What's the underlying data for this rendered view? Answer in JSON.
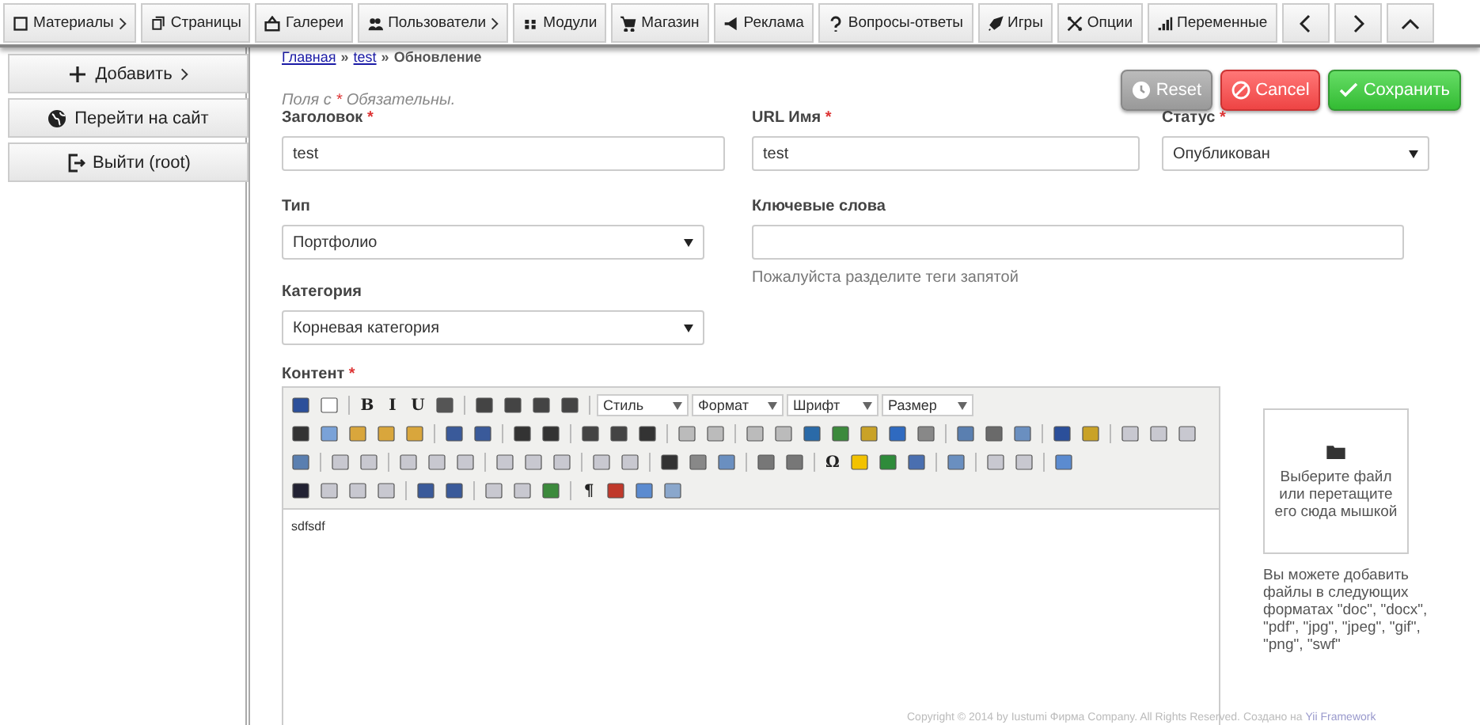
{
  "nav": {
    "items": [
      {
        "label": "Материалы",
        "submenu": true
      },
      {
        "label": "Страницы",
        "submenu": false
      },
      {
        "label": "Галереи",
        "submenu": false
      },
      {
        "label": "Пользователи",
        "submenu": true
      },
      {
        "label": "Модули",
        "submenu": false
      },
      {
        "label": "Магазин",
        "submenu": false
      },
      {
        "label": "Реклама",
        "submenu": false
      },
      {
        "label": "Вопросы-ответы",
        "submenu": false
      },
      {
        "label": "Игры",
        "submenu": false
      },
      {
        "label": "Опции",
        "submenu": false
      },
      {
        "label": "Переменные",
        "submenu": false
      }
    ]
  },
  "sidebar": {
    "buttons": [
      {
        "label": "Добавить",
        "submenu": true
      },
      {
        "label": "Перейти на сайт",
        "submenu": false
      },
      {
        "label": "Выйти (root)",
        "submenu": false
      }
    ]
  },
  "breadcrumb": [
    {
      "label": "Главная",
      "link": true
    },
    {
      "label": "test",
      "link": true
    },
    {
      "label": "Обновление",
      "link": false
    }
  ],
  "breadcrumb_separator": "»",
  "required_note": {
    "before": "Поля с",
    "mark": "*",
    "after": "Обязательны."
  },
  "actions": [
    {
      "label": "Reset",
      "kind": "reset"
    },
    {
      "label": "Cancel",
      "kind": "cancel"
    },
    {
      "label": "Сохранить",
      "kind": "save"
    }
  ],
  "fields": {
    "title": {
      "label": "Заголовок",
      "required": true,
      "value": "test"
    },
    "url": {
      "label": "URL Имя",
      "required": true,
      "value": "test"
    },
    "status": {
      "label": "Статус",
      "required": true,
      "value": "Опубликован"
    },
    "type": {
      "label": "Тип",
      "required": false,
      "value": "Портфолио"
    },
    "keywords": {
      "label": "Ключевые слова",
      "required": false,
      "hint": "Пожалуйста разделите теги запятой"
    },
    "category": {
      "label": "Категория",
      "required": false,
      "value": "Корневая категория"
    },
    "content": {
      "label": "Контент",
      "required": true,
      "value": "sdfsdf"
    }
  },
  "editor": {
    "combos": [
      "Стиль",
      "Формат",
      "Шрифт",
      "Размер"
    ],
    "glyphs": [
      "B",
      "I",
      "U",
      "Ω",
      "¶"
    ]
  },
  "upload": {
    "text": "Выберите файл или перетащите его сюда мышкой",
    "note": "Вы можете добавить файлы в следующих форматах \"doc\", \"docx\", \"pdf\", \"jpg\", \"jpeg\", \"gif\", \"png\", \"swf\""
  },
  "footer": {
    "text": "Copyright © 2014 by Iustumi Фирма Company. All Rights Reserved. Создано на",
    "link": "Yii Framework"
  }
}
